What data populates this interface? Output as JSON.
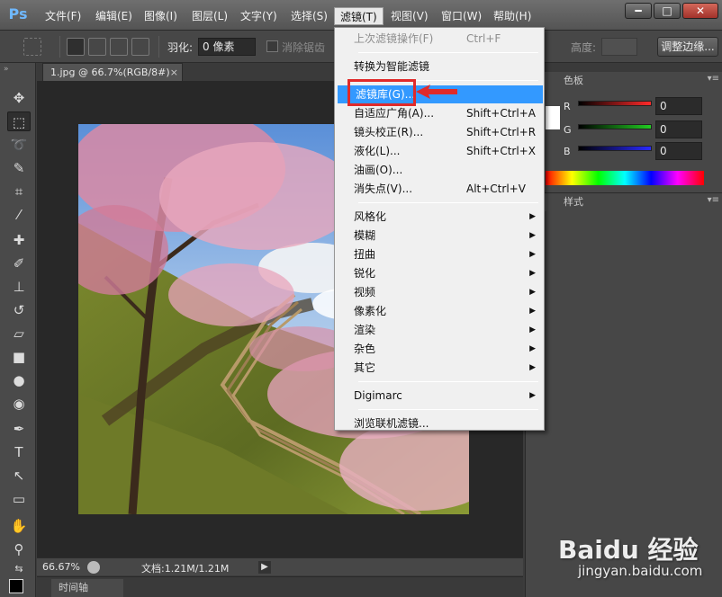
{
  "app": {
    "logo": "Ps"
  },
  "menubar": {
    "items": [
      {
        "label": "文件(F)"
      },
      {
        "label": "编辑(E)"
      },
      {
        "label": "图像(I)"
      },
      {
        "label": "图层(L)"
      },
      {
        "label": "文字(Y)"
      },
      {
        "label": "选择(S)"
      },
      {
        "label": "滤镜(T)"
      },
      {
        "label": "视图(V)"
      },
      {
        "label": "窗口(W)"
      },
      {
        "label": "帮助(H)"
      }
    ],
    "active_index": 6
  },
  "window_controls": {
    "minimize": "━",
    "restore": "□",
    "close": "✕"
  },
  "options_bar": {
    "feather_label": "羽化:",
    "feather_value": "0 像素",
    "antialias_label": "消除锯齿",
    "height_label": "高度:",
    "refine_label": "调整边缘..."
  },
  "document": {
    "tab_title": "1.jpg @ 66.7%(RGB/8#)",
    "tab_close": "×"
  },
  "status": {
    "zoom": "66.67%",
    "docsize": "文档:1.21M/1.21M",
    "timeline_tab": "时间轴"
  },
  "color_panel": {
    "tabs": [
      "色",
      "色板"
    ],
    "channels": [
      {
        "label": "R",
        "value": "0",
        "color": "#ff2a2a"
      },
      {
        "label": "G",
        "value": "0",
        "color": "#22cc22"
      },
      {
        "label": "B",
        "value": "0",
        "color": "#2a2aff"
      }
    ]
  },
  "styles_panel": {
    "tabs": [
      "式",
      "样式"
    ]
  },
  "filter_menu": {
    "items": [
      {
        "label": "上次滤镜操作(F)",
        "shortcut": "Ctrl+F",
        "disabled": true
      },
      {
        "separator": true
      },
      {
        "label": "转换为智能滤镜"
      },
      {
        "separator": true
      },
      {
        "label": "滤镜库(G)...",
        "highlight": true
      },
      {
        "label": "自适应广角(A)...",
        "shortcut": "Shift+Ctrl+A"
      },
      {
        "label": "镜头校正(R)...",
        "shortcut": "Shift+Ctrl+R"
      },
      {
        "label": "液化(L)...",
        "shortcut": "Shift+Ctrl+X"
      },
      {
        "label": "油画(O)..."
      },
      {
        "label": "消失点(V)...",
        "shortcut": "Alt+Ctrl+V"
      },
      {
        "separator": true
      },
      {
        "label": "风格化",
        "submenu": true
      },
      {
        "label": "模糊",
        "submenu": true
      },
      {
        "label": "扭曲",
        "submenu": true
      },
      {
        "label": "锐化",
        "submenu": true
      },
      {
        "label": "视频",
        "submenu": true
      },
      {
        "label": "像素化",
        "submenu": true
      },
      {
        "label": "渲染",
        "submenu": true
      },
      {
        "label": "杂色",
        "submenu": true
      },
      {
        "label": "其它",
        "submenu": true
      },
      {
        "separator": true
      },
      {
        "label": "Digimarc",
        "submenu": true
      },
      {
        "separator": true
      },
      {
        "label": "浏览联机滤镜..."
      }
    ]
  },
  "watermark": {
    "logo": "Baidu 经验",
    "url": "jingyan.baidu.com"
  }
}
